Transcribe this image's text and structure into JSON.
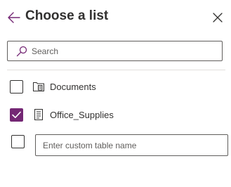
{
  "panel": {
    "title": "Choose a list",
    "back_icon": "arrow-left-icon",
    "close_icon": "close-icon"
  },
  "search": {
    "placeholder": "Search",
    "value": "",
    "icon": "search-icon"
  },
  "lists": [
    {
      "label": "Documents",
      "checked": false,
      "icon": "document-library-icon"
    },
    {
      "label": "Office_Supplies",
      "checked": true,
      "icon": "list-icon"
    }
  ],
  "custom_table": {
    "checked": false,
    "placeholder": "Enter custom table name",
    "value": ""
  },
  "colors": {
    "accent": "#742774",
    "text": "#323130",
    "border": "#605e5c",
    "divider": "#e1dfdd"
  }
}
